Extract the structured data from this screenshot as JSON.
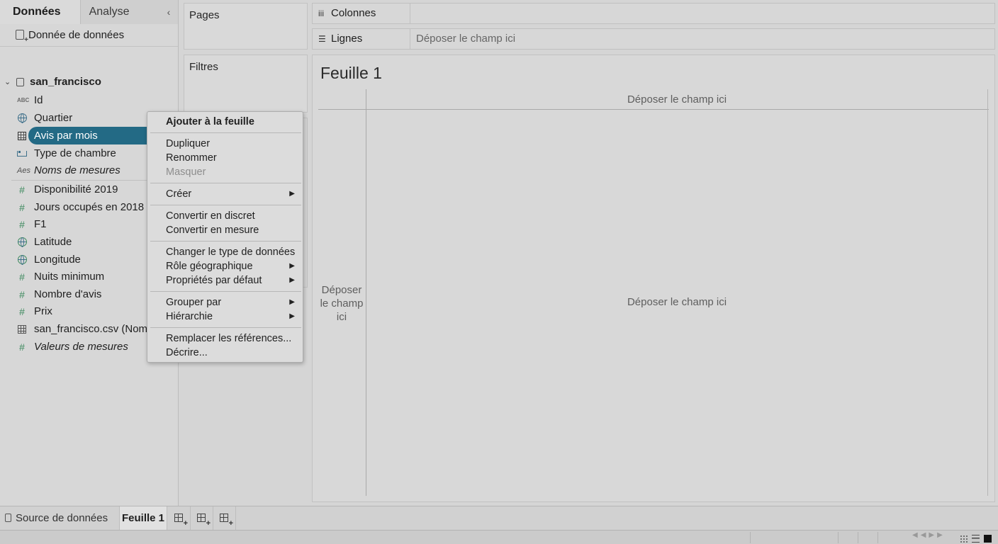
{
  "left_pane": {
    "tabs": {
      "data": "Données",
      "analytics": "Analyse",
      "collapse": "‹"
    },
    "data_source": "Donnée de données",
    "tree": {
      "root": "san_francisco",
      "dimensions": [
        {
          "label": "Id",
          "icon": "abc-icon"
        },
        {
          "label": "Quartier",
          "icon": "globe-icon"
        },
        {
          "label": "Avis par mois",
          "icon": "table-grid-icon",
          "selected": true
        },
        {
          "label": "Type de chambre",
          "icon": "bed-icon"
        },
        {
          "label": "Noms de mesures",
          "icon": "abc-italic-icon",
          "italic": true
        }
      ],
      "measures": [
        {
          "label": "Disponibilité 2019",
          "icon": "number-icon"
        },
        {
          "label": "Jours occupés en 2018",
          "icon": "number-icon"
        },
        {
          "label": "F1",
          "icon": "number-icon"
        },
        {
          "label": "Latitude",
          "icon": "globe-icon"
        },
        {
          "label": "Longitude",
          "icon": "globe-icon"
        },
        {
          "label": "Nuits minimum",
          "icon": "number-icon"
        },
        {
          "label": "Nombre d'avis",
          "icon": "number-icon"
        },
        {
          "label": "Prix",
          "icon": "number-icon"
        },
        {
          "label": "san_francisco.csv (Nomb",
          "icon": "table-grid-icon"
        },
        {
          "label": "Valeurs de mesures",
          "icon": "number-icon",
          "italic": true
        }
      ]
    }
  },
  "cards": {
    "pages": "Pages",
    "filters": "Filtres"
  },
  "shelves": {
    "columns": {
      "label": "Colonnes",
      "drop": ""
    },
    "rows": {
      "label": "Lignes",
      "drop": "Déposer le champ ici"
    }
  },
  "sheet": {
    "title": "Feuille 1",
    "top_drop": "Déposer le champ ici",
    "left_drop": "Déposer le champ ici",
    "center_drop": "Déposer le champ ici"
  },
  "context_menu": {
    "add": "Ajouter à la feuille",
    "duplicate": "Dupliquer",
    "rename": "Renommer",
    "hide": "Masquer",
    "create": "Créer",
    "convert_discrete": "Convertir en discret",
    "convert_measure": "Convertir en mesure",
    "change_type": "Changer le type de données",
    "geo_role": "Rôle géographique",
    "default_props": "Propriétés par défaut",
    "group_by": "Grouper par",
    "hierarchy": "Hiérarchie",
    "replace_refs": "Remplacer les références...",
    "describe": "Décrire..."
  },
  "bottom": {
    "source_tab": "Source de données",
    "sheet_tab": "Feuille 1"
  },
  "colors": {
    "selection": "#236a85",
    "measure_icon": "#3d8a5e",
    "dimension_icon": "#3d6f8a"
  }
}
